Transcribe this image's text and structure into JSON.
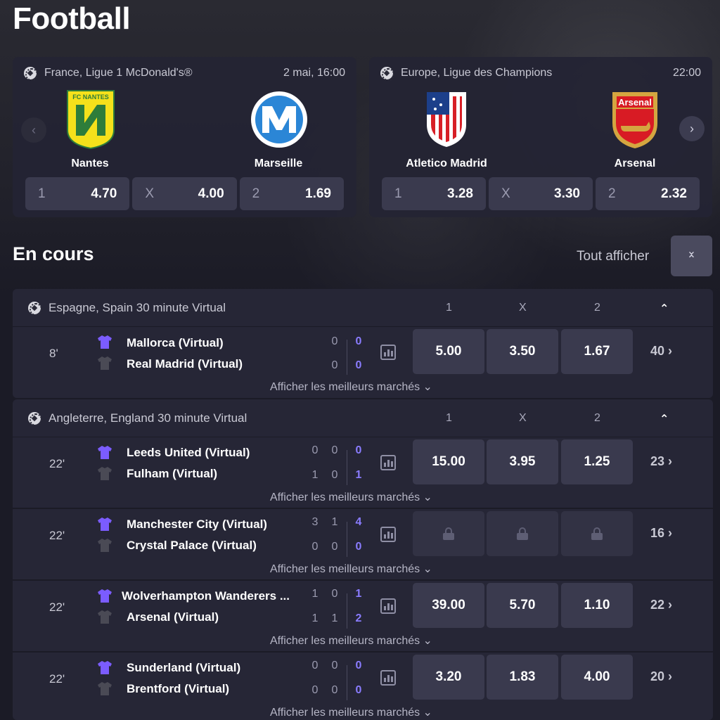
{
  "page": {
    "title": "Football"
  },
  "featured": [
    {
      "league": "France, Ligue 1 McDonald's®",
      "date": "2 mai, 16:00",
      "home": "Nantes",
      "away": "Marseille",
      "odds": [
        {
          "label": "1",
          "value": "4.70"
        },
        {
          "label": "X",
          "value": "4.00"
        },
        {
          "label": "2",
          "value": "1.69"
        }
      ],
      "home_crest_text": "FC NANTES"
    },
    {
      "league": "Europe, Ligue des Champions",
      "date": "22:00",
      "home": "Atletico Madrid",
      "away": "Arsenal",
      "odds": [
        {
          "label": "1",
          "value": "3.28"
        },
        {
          "label": "X",
          "value": "3.30"
        },
        {
          "label": "2",
          "value": "2.32"
        }
      ],
      "away_crest_text": "Arsenal"
    }
  ],
  "live": {
    "title": "En cours",
    "show_all": "Tout afficher"
  },
  "columns": {
    "c1": "1",
    "cx": "X",
    "c2": "2"
  },
  "leagues": [
    {
      "name": "Espagne, Spain 30 minute Virtual",
      "matches": [
        {
          "time": "8'",
          "home": "Mallorca (Virtual)",
          "away": "Real Madrid (Virtual)",
          "home_scores": [
            "0",
            "0"
          ],
          "away_scores": [
            "0",
            "0"
          ],
          "odds": [
            "5.00",
            "3.50",
            "1.67"
          ],
          "more": "40",
          "markets": "Afficher les meilleurs marchés"
        }
      ]
    },
    {
      "name": "Angleterre, England 30 minute Virtual",
      "matches": [
        {
          "time": "22'",
          "home": "Leeds United (Virtual)",
          "away": "Fulham (Virtual)",
          "home_scores": [
            "0",
            "0",
            "0"
          ],
          "away_scores": [
            "1",
            "0",
            "1"
          ],
          "odds": [
            "15.00",
            "3.95",
            "1.25"
          ],
          "more": "23",
          "markets": "Afficher les meilleurs marchés"
        },
        {
          "time": "22'",
          "home": "Manchester City (Virtual)",
          "away": "Crystal Palace (Virtual)",
          "home_scores": [
            "3",
            "1",
            "4"
          ],
          "away_scores": [
            "0",
            "0",
            "0"
          ],
          "odds": [
            "locked",
            "locked",
            "locked"
          ],
          "more": "16",
          "markets": "Afficher les meilleurs marchés"
        },
        {
          "time": "22'",
          "home": "Wolverhampton Wanderers ...",
          "away": "Arsenal (Virtual)",
          "home_scores": [
            "1",
            "0",
            "1"
          ],
          "away_scores": [
            "1",
            "1",
            "2"
          ],
          "odds": [
            "39.00",
            "5.70",
            "1.10"
          ],
          "more": "22",
          "markets": "Afficher les meilleurs marchés"
        },
        {
          "time": "22'",
          "home": "Sunderland (Virtual)",
          "away": "Brentford (Virtual)",
          "home_scores": [
            "0",
            "0",
            "0"
          ],
          "away_scores": [
            "0",
            "0",
            "0"
          ],
          "odds": [
            "3.20",
            "1.83",
            "4.00"
          ],
          "more": "20",
          "markets": "Afficher les meilleurs marchés"
        }
      ]
    }
  ],
  "colors": {
    "background": "#1b1b26",
    "card": "#262636",
    "button": "#3a3a4e",
    "live_score": "#8a7cff",
    "shirt_home": "#7b5cff",
    "shirt_away": "#4a4a55"
  }
}
